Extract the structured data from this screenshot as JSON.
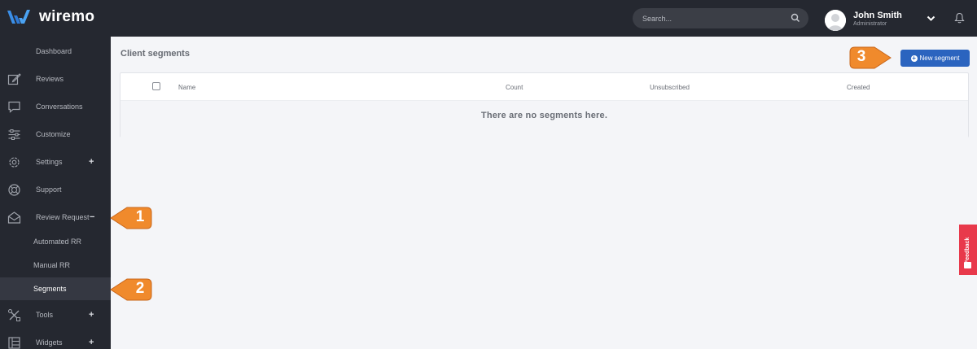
{
  "app": {
    "name": "wiremo"
  },
  "search": {
    "placeholder": "Search..."
  },
  "user": {
    "name": "John Smith",
    "role": "Administrator"
  },
  "sidebar": {
    "items": [
      {
        "label": "Dashboard",
        "icon": "dashboard-icon"
      },
      {
        "label": "Reviews",
        "icon": "edit-icon"
      },
      {
        "label": "Conversations",
        "icon": "chat-icon"
      },
      {
        "label": "Customize",
        "icon": "sliders-icon"
      },
      {
        "label": "Settings",
        "icon": "gear-icon",
        "toggle": "+"
      },
      {
        "label": "Support",
        "icon": "lifebuoy-icon"
      },
      {
        "label": "Review Request",
        "icon": "envelope-icon",
        "toggle": "−"
      },
      {
        "label": "Tools",
        "icon": "tools-icon",
        "toggle": "+"
      },
      {
        "label": "Widgets",
        "icon": "widgets-icon",
        "toggle": "+"
      }
    ],
    "sub_items": [
      {
        "label": "Automated RR"
      },
      {
        "label": "Manual RR"
      },
      {
        "label": "Segments",
        "active": true
      }
    ]
  },
  "main": {
    "title": "Client segments",
    "new_button": "New segment",
    "table": {
      "columns": [
        "Name",
        "Count",
        "Unsubscribed",
        "Created"
      ],
      "empty_message": "There are no segments here."
    }
  },
  "feedback": {
    "label": "Feedback"
  },
  "callouts": [
    "1",
    "2",
    "3"
  ],
  "colors": {
    "topbar": "#252830",
    "sidebar": "#252830",
    "accent": "#2b64bf",
    "feedback": "#e8394b",
    "callout": "#f08a2c",
    "logo": "#3b8fe8"
  }
}
